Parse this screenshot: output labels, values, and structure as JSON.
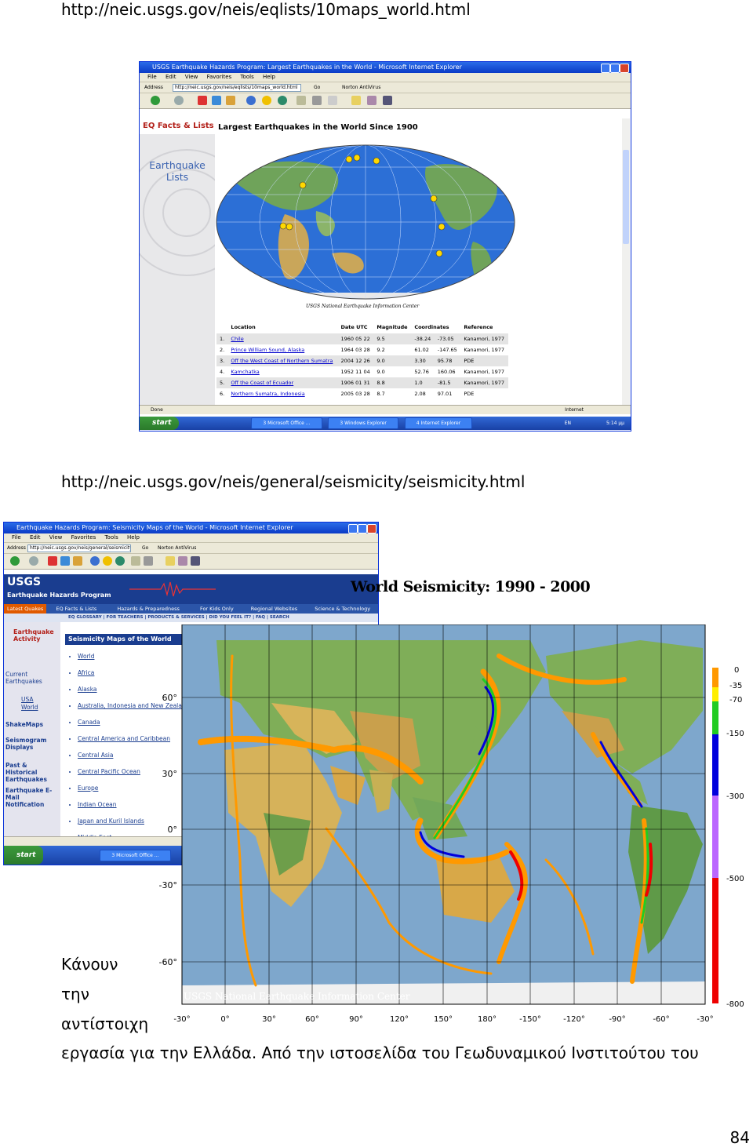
{
  "url1": "http://neic.usgs.gov/neis/eqlists/10maps_world.html",
  "url2": "http://neic.usgs.gov/neis/general/seismicity/seismicity.html",
  "win1": {
    "title": "USGS Earthquake Hazards Program: Largest Earthquakes in the World - Microsoft Internet Explorer",
    "menu": [
      "File",
      "Edit",
      "View",
      "Favorites",
      "Tools",
      "Help"
    ],
    "address_label": "Address",
    "address": "http://neic.usgs.gov/neis/eqlists/10maps_world.html",
    "go": "Go",
    "norton": "Norton AntiVirus",
    "site_tab": "EQ Facts & Lists",
    "heading": "Largest Earthquakes in the World Since 1900",
    "side_title": "Earthquake Lists",
    "credit": "USGS National Earthquake Information Center",
    "table": {
      "headers": [
        "Location",
        "Date UTC",
        "Magnitude",
        "Coordinates",
        "",
        "Reference"
      ],
      "rows": [
        [
          "1.",
          "Chile",
          "1960 05 22",
          "9.5",
          "-38.24",
          "-73.05",
          "Kanamori, 1977"
        ],
        [
          "2.",
          "Prince William Sound, Alaska",
          "1964 03 28",
          "9.2",
          "61.02",
          "-147.65",
          "Kanamori, 1977"
        ],
        [
          "3.",
          "Off the West Coast of Northern Sumatra",
          "2004 12 26",
          "9.0",
          "3.30",
          "95.78",
          "PDE"
        ],
        [
          "4.",
          "Kamchatka",
          "1952 11 04",
          "9.0",
          "52.76",
          "160.06",
          "Kanamori, 1977"
        ],
        [
          "5.",
          "Off the Coast of Ecuador",
          "1906 01 31",
          "8.8",
          "1.0",
          "-81.5",
          "Kanamori, 1977"
        ],
        [
          "6.",
          "Northern Sumatra, Indonesia",
          "2005 03 28",
          "8.7",
          "2.08",
          "97.01",
          "PDE"
        ]
      ]
    },
    "status": "Done",
    "zone": "Internet",
    "taskbar": {
      "start": "start",
      "tasks": [
        "3 Microsoft Office ...",
        "3 Windows Explorer",
        "4 Internet Explorer"
      ],
      "lang": "EN",
      "time": "5:14 μμ"
    }
  },
  "win2": {
    "title": "Earthquake Hazards Program: Seismicity Maps of the World - Microsoft Internet Explorer",
    "menu": [
      "File",
      "Edit",
      "View",
      "Favorites",
      "Tools",
      "Help"
    ],
    "address_label": "Address",
    "address": "http://neic.usgs.gov/neis/general/seismicity/seismicity.html",
    "go": "Go",
    "norton": "Norton AntiVirus",
    "logo": "USGS",
    "program": "Earthquake Hazards Program",
    "nav1": [
      "Latest Quakes",
      "EQ Facts & Lists",
      "Hazards & Preparedness",
      "For Kids Only",
      "Regional Websites",
      "Science & Technology"
    ],
    "nav2": [
      "EQ GLOSSARY",
      "FOR TEACHERS",
      "PRODUCTS & SERVICES",
      "DID YOU FEEL IT?",
      "FAQ",
      "SEARCH"
    ],
    "side_title": "Earthquake Activity",
    "side_links": [
      "Current Earthquakes",
      "USA",
      "World",
      "ShakeMaps",
      "Seismogram Displays",
      "Past & Historical Earthquakes",
      "Earthquake E-Mail Notification"
    ],
    "content_heading": "Seismicity Maps of the World",
    "regions": [
      "World",
      "Africa",
      "Alaska",
      "Australia, Indonesia and New Zealand",
      "Canada",
      "Central America and Caribbean",
      "Central Asia",
      "Central Pacific Ocean",
      "Europe",
      "Indian Ocean",
      "Japan and Kuril Islands",
      "Middle East"
    ],
    "taskbar": {
      "start": "start",
      "tasks": [
        "3 Microsoft Office ..."
      ]
    }
  },
  "seismicity": {
    "title": "World Seismicity: 1990 - 2000",
    "credit": "USGS National Earthquake Information Center",
    "lat_labels": [
      "60°",
      "30°",
      "0°",
      "-30°",
      "-60°"
    ],
    "lon_labels": [
      "-30°",
      "0°",
      "30°",
      "60°",
      "90°",
      "120°",
      "150°",
      "180°",
      "-150°",
      "-120°",
      "-90°",
      "-60°",
      "-30°"
    ],
    "depth_labels": [
      "0",
      "-35",
      "-70",
      "-150",
      "-300",
      "-500",
      "-800"
    ],
    "depth_colors": [
      "#ff9900",
      "#ffee00",
      "#22cc22",
      "#0000dd",
      "#bb66ff",
      "#ee0000"
    ]
  },
  "greek": {
    "line1": "Κάνουν",
    "line2": "την",
    "line3": "αντίστοιχη",
    "line4": "εργασία για την Ελλάδα. Από την ιστοσελίδα του Γεωδυναμικού Ινστιτούτου του"
  },
  "page_number": "84"
}
